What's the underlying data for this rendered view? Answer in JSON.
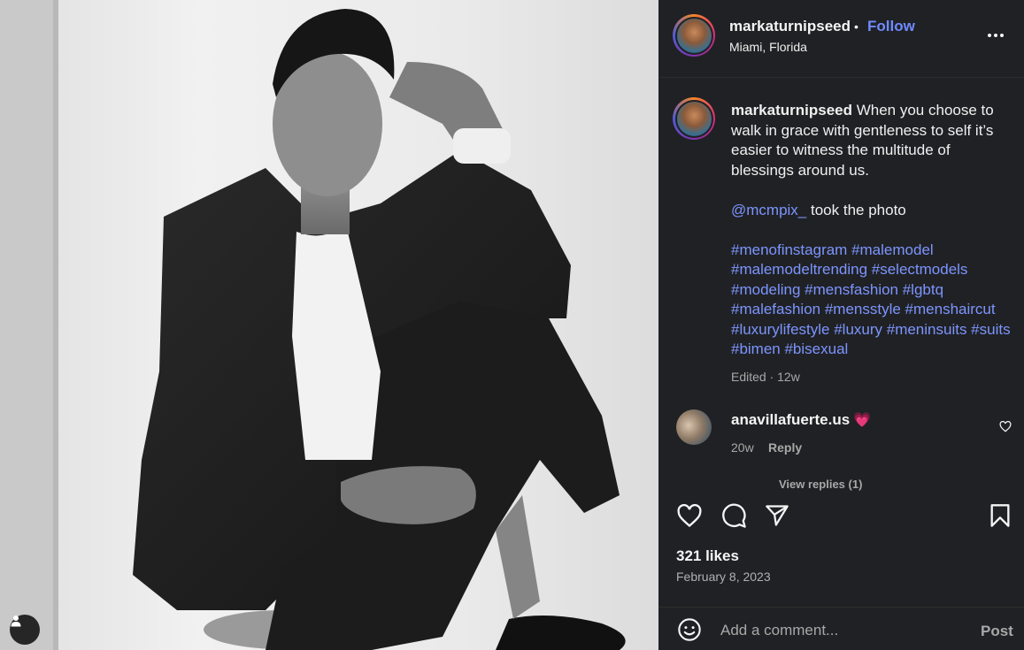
{
  "post": {
    "author": "markaturnipseed",
    "separator": "•",
    "follow_label": "Follow",
    "location": "Miami, Florida",
    "more_icon": "more-horizontal-icon"
  },
  "caption": {
    "author": "markaturnipseed",
    "text": " When you choose to walk in grace with gentleness to self it’s easier to witness the multitude of blessings around us.",
    "mention": "@mcmpix_",
    "mention_suffix": " took the photo",
    "hashtags": "#menofinstagram #malemodel #malemodeltrending #selectmodels #modeling #mensfashion #lgbtq #malefashion #mensstyle #menshaircut #luxurylifestyle #luxury #meninsuits #suits #bimen #bisexual",
    "meta": "Edited · 12w"
  },
  "comments": [
    {
      "author": "anavillafuerte.us",
      "emoji": "💗",
      "time": "20w",
      "reply_label": "Reply",
      "view_replies": "View replies (1)"
    }
  ],
  "actions": {
    "likes": "321 likes",
    "date": "February 8, 2023"
  },
  "comment_box": {
    "placeholder": "Add a comment...",
    "post_label": "Post",
    "emoji_icon": "emoji-icon"
  },
  "colors": {
    "panel_bg": "#202124",
    "link": "#7c95ff",
    "follow": "#6e8bff",
    "heart_emoji": "#ff4d6d"
  }
}
